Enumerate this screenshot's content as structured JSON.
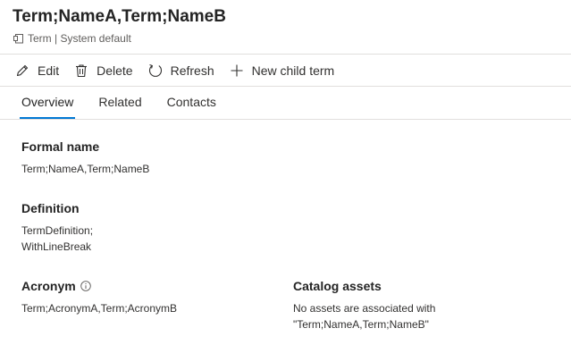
{
  "header": {
    "title": "Term;NameA,Term;NameB",
    "subtitle": "Term | System default",
    "subtitle_icon": "term-icon"
  },
  "toolbar": {
    "edit_label": "Edit",
    "delete_label": "Delete",
    "refresh_label": "Refresh",
    "new_child_label": "New child term"
  },
  "tabs": [
    {
      "label": "Overview",
      "active": true
    },
    {
      "label": "Related",
      "active": false
    },
    {
      "label": "Contacts",
      "active": false
    }
  ],
  "overview": {
    "formal_name": {
      "label": "Formal name",
      "value": "Term;NameA,Term;NameB"
    },
    "definition": {
      "label": "Definition",
      "lines": [
        "TermDefinition;",
        "WithLineBreak"
      ]
    },
    "acronym": {
      "label": "Acronym",
      "value": "Term;AcronymA,Term;AcronymB"
    },
    "catalog_assets": {
      "label": "Catalog assets",
      "lines": [
        "No assets are associated with",
        "\"Term;NameA,Term;NameB\""
      ]
    }
  },
  "colors": {
    "accent": "#0078d4",
    "text": "#323130",
    "muted": "#605e5c",
    "divider": "#e1dfdd"
  }
}
